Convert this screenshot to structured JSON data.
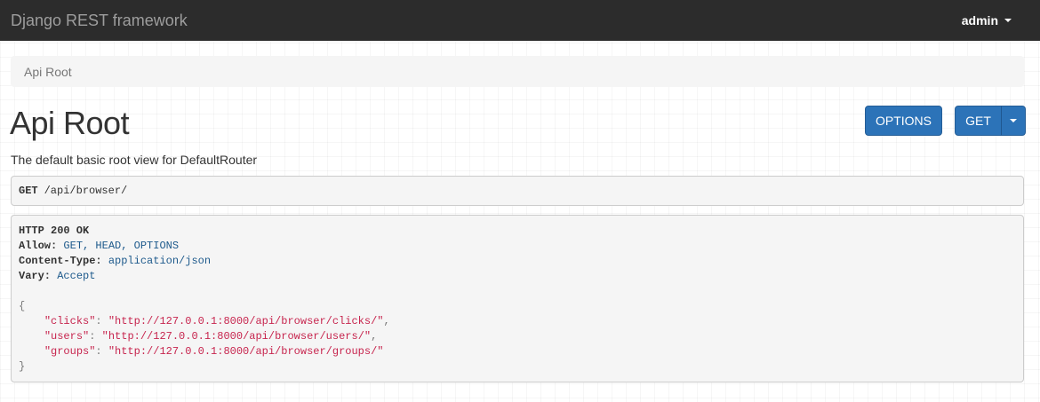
{
  "navbar": {
    "brand": "Django REST framework",
    "user": "admin"
  },
  "breadcrumb": {
    "items": [
      "Api Root"
    ]
  },
  "page": {
    "title": "Api Root",
    "description": "The default basic root view for DefaultRouter"
  },
  "buttons": {
    "options": "OPTIONS",
    "get": "GET"
  },
  "request": {
    "method": "GET",
    "path": "/api/browser/"
  },
  "response": {
    "status": "HTTP 200 OK",
    "headers": [
      {
        "name": "Allow:",
        "value": "GET, HEAD, OPTIONS"
      },
      {
        "name": "Content-Type:",
        "value": "application/json"
      },
      {
        "name": "Vary:",
        "value": "Accept"
      }
    ],
    "body": {
      "open": "{",
      "close": "}",
      "entries": [
        {
          "key": "\"clicks\"",
          "value": "\"http://127.0.0.1:8000/api/browser/clicks/\"",
          "trail": ","
        },
        {
          "key": "\"users\"",
          "value": "\"http://127.0.0.1:8000/api/browser/users/\"",
          "trail": ","
        },
        {
          "key": "\"groups\"",
          "value": "\"http://127.0.0.1:8000/api/browser/groups/\"",
          "trail": ""
        }
      ]
    }
  },
  "colors": {
    "navbar_bg": "#2c2c2c",
    "button_primary": "#2c73b8",
    "json_string": "#c7254e",
    "header_value": "#1e5a8c"
  }
}
